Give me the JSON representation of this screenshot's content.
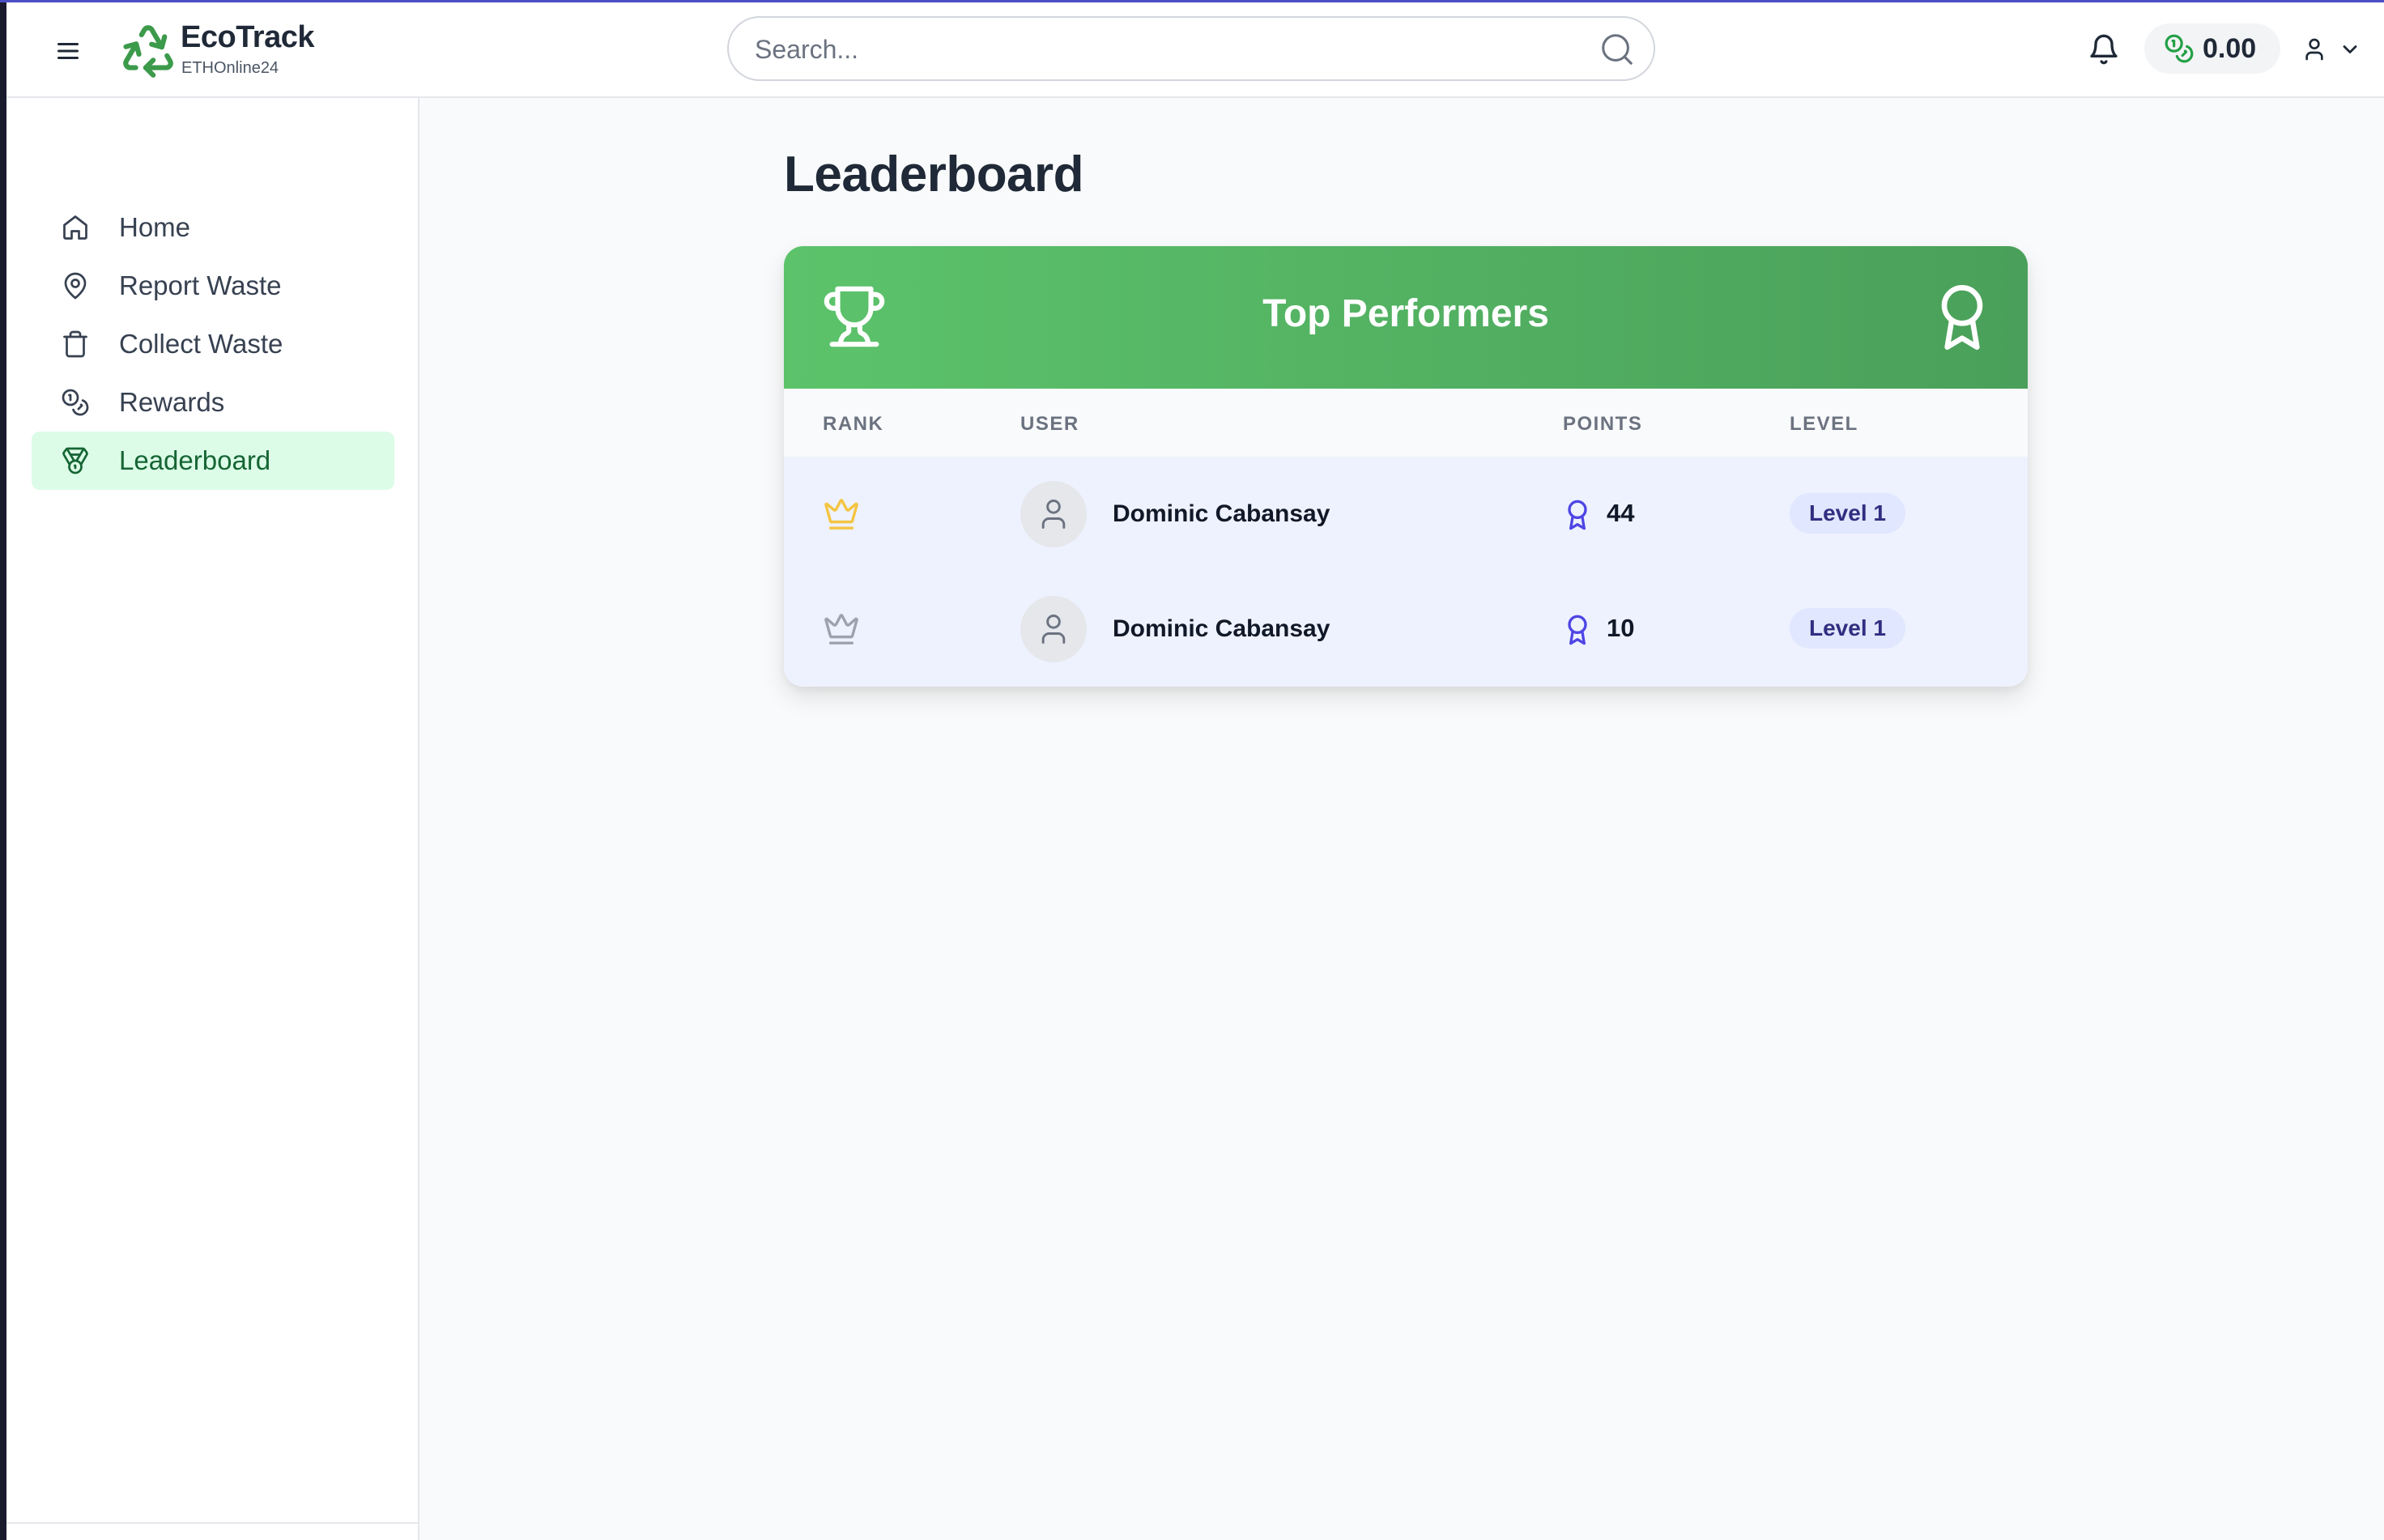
{
  "brand": {
    "name": "EcoTrack",
    "subtitle": "ETHOnline24"
  },
  "search": {
    "placeholder": "Search..."
  },
  "header": {
    "balance": "0.00"
  },
  "sidebar": {
    "items": [
      {
        "label": "Home",
        "icon": "home-icon"
      },
      {
        "label": "Report Waste",
        "icon": "map-pin-icon"
      },
      {
        "label": "Collect Waste",
        "icon": "trash-icon"
      },
      {
        "label": "Rewards",
        "icon": "coins-icon"
      },
      {
        "label": "Leaderboard",
        "icon": "medal-icon",
        "active": true
      }
    ]
  },
  "page": {
    "title": "Leaderboard"
  },
  "leaderboard": {
    "title": "Top Performers",
    "columns": [
      "RANK",
      "USER",
      "POINTS",
      "LEVEL"
    ],
    "rows": [
      {
        "rank_icon": "crown-gold-icon",
        "user": "Dominic Cabansay",
        "points": "44",
        "level": "Level 1"
      },
      {
        "rank_icon": "crown-silver-icon",
        "user": "Dominic Cabansay",
        "points": "10",
        "level": "Level 1"
      }
    ]
  },
  "colors": {
    "brand_green": "#4aa05a",
    "active_bg": "#dcfce7",
    "row_bg": "#eef2ff",
    "level_badge_bg": "#e0e7ff",
    "gold": "#f5c542",
    "silver": "#9ca3af",
    "points_icon": "#4f46e5"
  }
}
